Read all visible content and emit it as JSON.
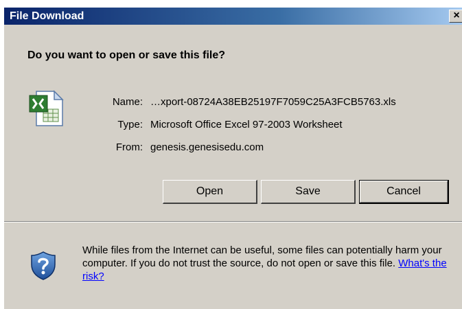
{
  "window": {
    "title": "File Download",
    "close_label": "×"
  },
  "dialog": {
    "question": "Do you want to open or save this file?",
    "file_icon": "excel-file-icon",
    "fields": {
      "name_label": "Name:",
      "name_value": "…xport-08724A38EB25197F7059C25A3FCB5763.xls",
      "type_label": "Type:",
      "type_value": "Microsoft Office Excel 97-2003 Worksheet",
      "from_label": "From:",
      "from_value": "genesis.genesisedu.com"
    },
    "buttons": {
      "open": "Open",
      "save": "Save",
      "cancel": "Cancel"
    },
    "warning": {
      "icon": "shield-question-icon",
      "text": "While files from the Internet can be useful, some files can potentially harm your computer. If you do not trust the source, do not open or save this file.",
      "link": "What's the risk?"
    }
  },
  "colors": {
    "title_bar": "#0a246a",
    "dialog_bg": "#d4d0c8",
    "link": "#0000ff",
    "shield": "#1f5fb0"
  }
}
